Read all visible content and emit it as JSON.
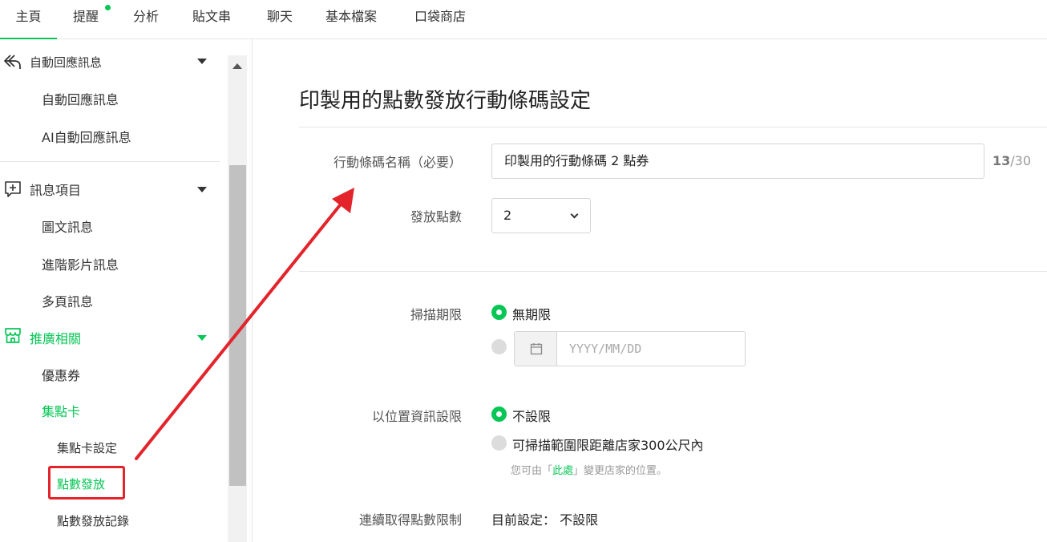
{
  "nav": {
    "tabs": [
      "主頁",
      "提醒",
      "分析",
      "貼文串",
      "聊天",
      "基本檔案",
      "口袋商店"
    ]
  },
  "sidebar": {
    "auto_reply_section": "自動回應訊息",
    "auto_reply_item": "自動回應訊息",
    "ai_auto_reply_item": "AI自動回應訊息",
    "message_section": "訊息項目",
    "rich_message": "圖文訊息",
    "rich_video": "進階影片訊息",
    "card_message": "多頁訊息",
    "promo_section": "推廣相關",
    "coupon": "優惠券",
    "reward_card": "集點卡",
    "reward_card_settings": "集點卡設定",
    "points_issue": "點數發放",
    "points_history": "點數發放記錄"
  },
  "main": {
    "title": "印製用的點數發放行動條碼設定",
    "name_label": "行動條碼名稱（必要）",
    "name_value": "印製用的行動條碼 2 點券",
    "char_count": "13",
    "char_max": "/30",
    "points_label": "發放點數",
    "points_value": "2",
    "scan_limit_label": "掃描期限",
    "scan_unlimited": "無期限",
    "date_placeholder": "YYYY/MM/DD",
    "location_label": "以位置資訊設限",
    "location_none": "不設限",
    "location_range": "可掃描範圍限距離店家300公尺內",
    "location_note_prefix": "您可由「",
    "location_note_link": "此處",
    "location_note_suffix": "」變更店家的位置。",
    "consecutive_label": "連續取得點數限制",
    "consecutive_value": "目前設定： 不設限"
  },
  "colors": {
    "accent": "#06c755",
    "annotation": "#e3242b"
  }
}
